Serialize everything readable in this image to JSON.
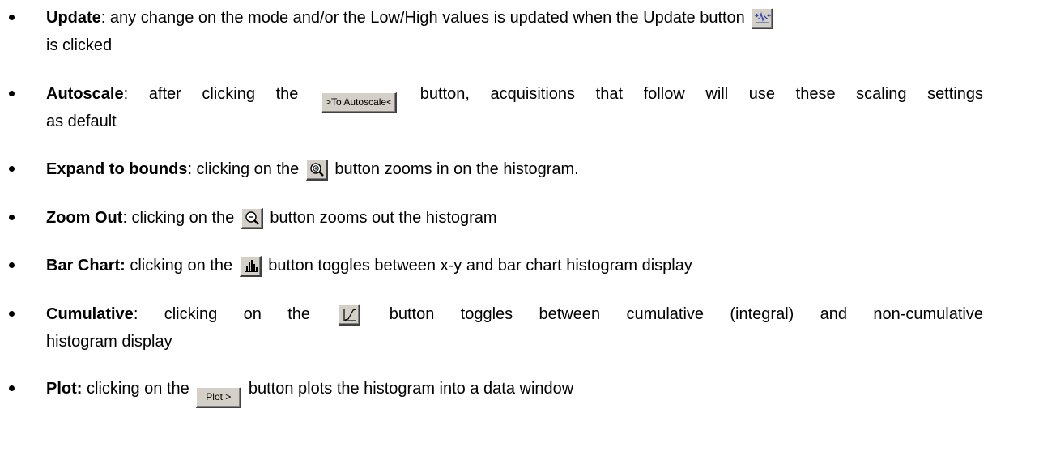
{
  "items": [
    {
      "term": "Update",
      "line1_before": ": any change on the mode and/or the Low/High values is updated when the Update button",
      "icon": "update-autoscale-arrows-icon",
      "line2": "is clicked"
    },
    {
      "term": "Autoscale",
      "line1_before": ": after clicking the",
      "button_label": ">To Autoscale<",
      "line1_after": "button, acquisitions that follow will use these scaling settings",
      "line2": "as default"
    },
    {
      "term": "Expand to bounds",
      "line1_before": ": clicking on the",
      "icon": "zoom-in-magnifier-icon",
      "line1_after": "button zooms in on the histogram."
    },
    {
      "term": "Zoom Out",
      "line1_before": ": clicking on the",
      "icon": "zoom-out-magnifier-icon",
      "line1_after": "button zooms out the histogram"
    },
    {
      "term": "Bar Chart:",
      "line1_before": " clicking on the",
      "icon": "bar-chart-icon",
      "line1_after": "button toggles between x-y and bar chart histogram display"
    },
    {
      "term": "Cumulative",
      "line1_before": ": clicking on the",
      "icon": "cumulative-curve-icon",
      "line1_after": "button toggles between cumulative (integral) and non-cumulative",
      "line2": "histogram display"
    },
    {
      "term": "Plot:",
      "line1_before": " clicking on the",
      "button_label": "Plot >",
      "line1_after": "button plots the histogram into a data window"
    }
  ],
  "colors": {
    "text": "#000000",
    "button_face": "#d4d0c8",
    "icon_blue": "#1f3fb0"
  }
}
